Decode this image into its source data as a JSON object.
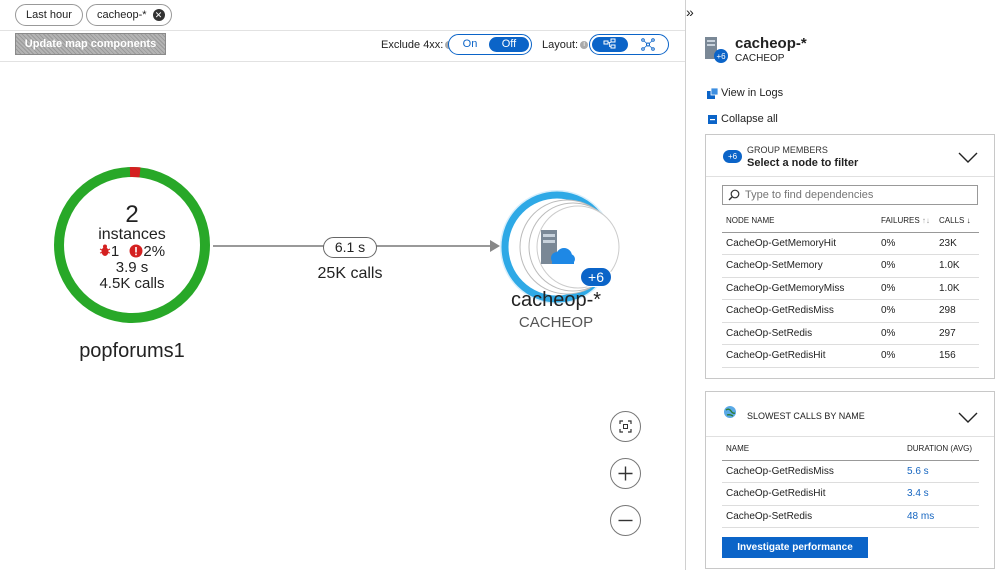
{
  "topbar": {
    "time_range": "Last hour",
    "filter": "cacheop-*",
    "update_button": "Update map components",
    "exclude_label": "Exclude 4xx:",
    "exclude_on": "On",
    "exclude_off": "Off",
    "exclude_selected": "Off",
    "layout_label": "Layout:"
  },
  "map": {
    "source_node": {
      "count": "2",
      "instances_label": "instances",
      "alert_count": "1",
      "failure_rate": "2%",
      "duration": "3.9 s",
      "calls": "4.5K calls",
      "name": "popforums1",
      "colors": {
        "healthy": "#28a828",
        "failed": "#d42020"
      }
    },
    "edge": {
      "duration": "6.1 s",
      "calls": "25K calls"
    },
    "target_node": {
      "name": "cacheop-*",
      "type": "CACHEOP",
      "group_badge": "+6",
      "ring_color": "#2ea9e6"
    }
  },
  "panel": {
    "collapse_icon": "»",
    "service_name": "cacheop-*",
    "service_type": "CACHEOP",
    "view_logs": "View in Logs",
    "collapse_all": "Collapse all",
    "group_members": {
      "badge": "+6",
      "title": "GROUP MEMBERS",
      "subtitle": "Select a node to filter",
      "search_placeholder": "Type to find dependencies",
      "columns": {
        "name": "NODE NAME",
        "failures": "FAILURES",
        "calls": "CALLS"
      },
      "rows": [
        {
          "name": "CacheOp-GetMemoryHit",
          "failures": "0%",
          "calls": "23K"
        },
        {
          "name": "CacheOp-SetMemory",
          "failures": "0%",
          "calls": "1.0K"
        },
        {
          "name": "CacheOp-GetMemoryMiss",
          "failures": "0%",
          "calls": "1.0K"
        },
        {
          "name": "CacheOp-GetRedisMiss",
          "failures": "0%",
          "calls": "298"
        },
        {
          "name": "CacheOp-SetRedis",
          "failures": "0%",
          "calls": "297"
        },
        {
          "name": "CacheOp-GetRedisHit",
          "failures": "0%",
          "calls": "156"
        }
      ]
    },
    "slowest": {
      "title": "SLOWEST CALLS BY NAME",
      "columns": {
        "name": "NAME",
        "duration": "DURATION (AVG)"
      },
      "rows": [
        {
          "name": "CacheOp-GetRedisMiss",
          "duration": "5.6 s"
        },
        {
          "name": "CacheOp-GetRedisHit",
          "duration": "3.4 s"
        },
        {
          "name": "CacheOp-SetRedis",
          "duration": "48 ms"
        }
      ],
      "investigate_button": "Investigate performance"
    },
    "accent_color": "#0b64c8"
  }
}
